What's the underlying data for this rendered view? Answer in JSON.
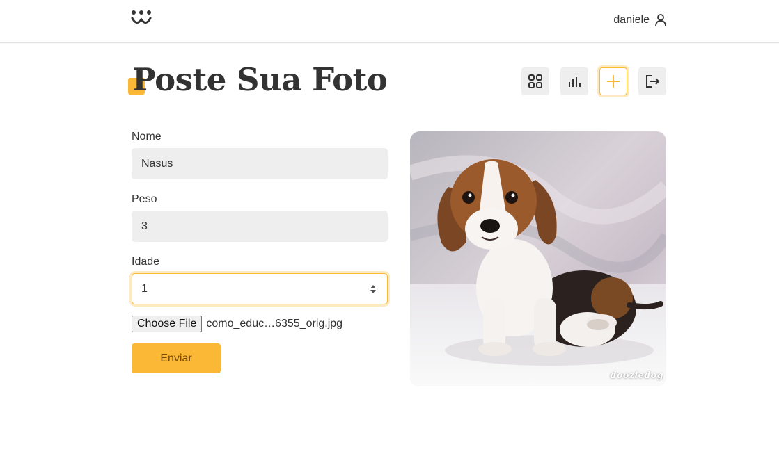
{
  "header": {
    "logo_icon": "dog-face-logo-icon",
    "username": "daniele",
    "user_icon": "user-icon"
  },
  "page": {
    "title": "Poste Sua Foto"
  },
  "actions": [
    {
      "icon": "grid-icon",
      "active": false
    },
    {
      "icon": "stats-icon",
      "active": false
    },
    {
      "icon": "plus-icon",
      "active": true
    },
    {
      "icon": "logout-icon",
      "active": false
    }
  ],
  "form": {
    "nome": {
      "label": "Nome",
      "value": "Nasus"
    },
    "peso": {
      "label": "Peso",
      "value": "3"
    },
    "idade": {
      "label": "Idade",
      "value": "1"
    },
    "file": {
      "button_label": "Choose File",
      "file_name": "como_educ…6355_orig.jpg"
    },
    "submit_label": "Enviar"
  },
  "preview": {
    "watermark": "dooziedog"
  },
  "colors": {
    "accent": "#fbb836",
    "accent_text": "#764701",
    "field_bg": "#eeeeee"
  }
}
